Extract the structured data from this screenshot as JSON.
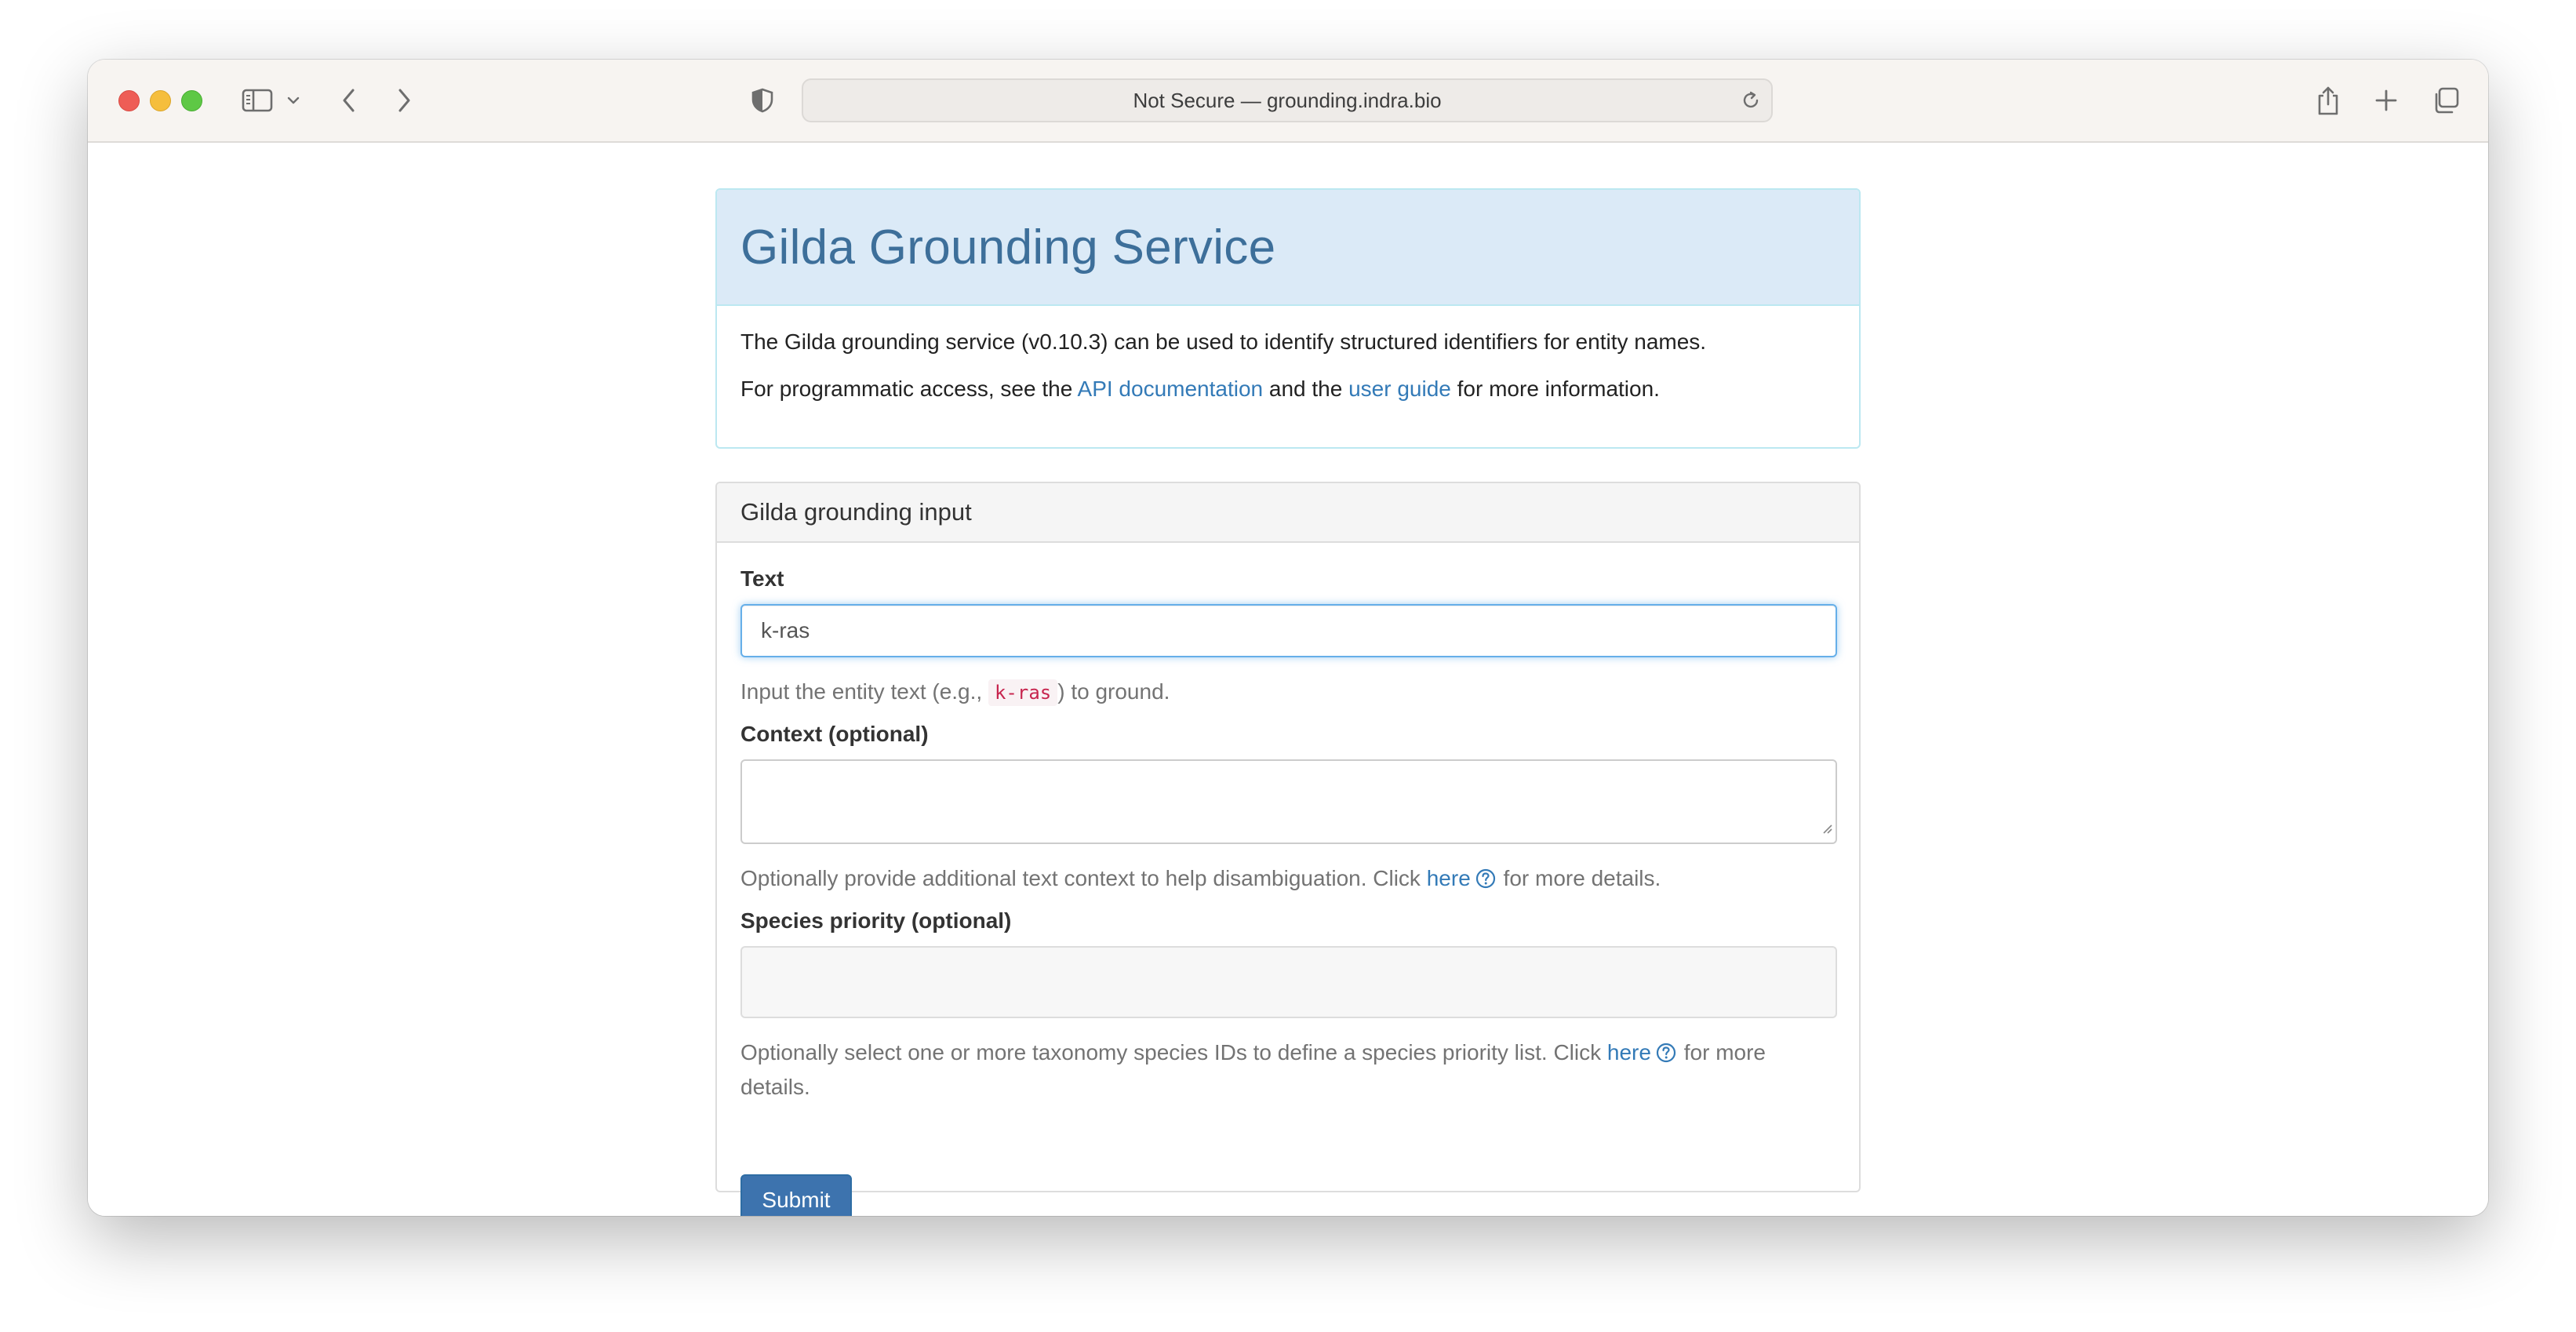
{
  "browser": {
    "url_text": "Not Secure — grounding.indra.bio"
  },
  "page": {
    "title": "Gilda Grounding Service",
    "intro_line": "The Gilda grounding service (v0.10.3) can be used to identify structured identifiers for entity names.",
    "access_prefix": "For programmatic access, see the ",
    "api_doc_link": "API documentation",
    "access_middle": " and the ",
    "user_guide_link": "user guide",
    "access_suffix": " for more information."
  },
  "form": {
    "panel_title": "Gilda grounding input",
    "text_label": "Text",
    "text_value": "k-ras",
    "text_help_prefix": "Input the entity text (e.g., ",
    "text_help_code": "k-ras",
    "text_help_suffix": ") to ground.",
    "context_label": "Context (optional)",
    "context_value": "",
    "context_help_prefix": "Optionally provide additional text context to help disambiguation. Click ",
    "context_help_link": "here",
    "context_help_suffix": " for more details.",
    "species_label": "Species priority (optional)",
    "species_help_prefix": "Optionally select one or more taxonomy species IDs to define a species priority list. Click ",
    "species_help_link": "here",
    "species_help_suffix": " for more details.",
    "submit_label": "Submit"
  },
  "colors": {
    "title_blue": "#3d6f9a",
    "link_blue": "#337ab7",
    "submit_blue": "#3d73ae",
    "code_red": "#c7254e"
  },
  "icons": {
    "toolbar": [
      "sidebar-icon",
      "chevron-down-icon",
      "back-icon",
      "forward-icon",
      "shield-icon",
      "reload-icon",
      "share-icon",
      "new-tab-icon",
      "tab-overview-icon"
    ],
    "help": "question-circle-icon"
  }
}
